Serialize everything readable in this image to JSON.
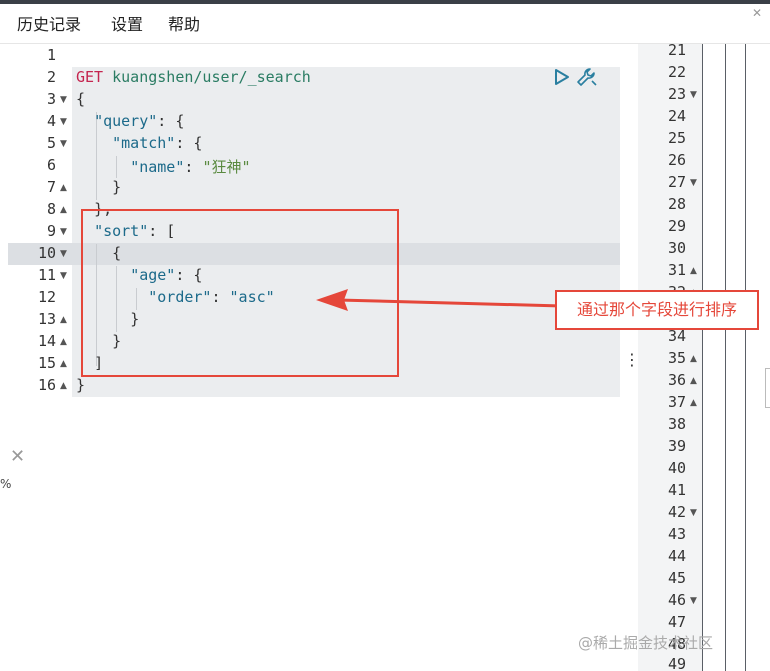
{
  "menu": {
    "history": "历史记录",
    "settings": "设置",
    "help": "帮助"
  },
  "editor": {
    "line_numbers": [
      "1",
      "2",
      "3",
      "4",
      "5",
      "6",
      "7",
      "8",
      "9",
      "10",
      "11",
      "12",
      "13",
      "14",
      "15",
      "16"
    ],
    "lines": {
      "l2_method": "GET",
      "l2_path": "kuangshen/user/_search",
      "l3": "{",
      "l4_key": "\"query\"",
      "l4_rest": ": {",
      "l5_key": "\"match\"",
      "l5_rest": ": {",
      "l6_key": "\"name\"",
      "l6_colon": ": ",
      "l6_val": "\"狂神\"",
      "l7": "}",
      "l8": "},",
      "l9_key": "\"sort\"",
      "l9_rest": ": [",
      "l10": "{",
      "l11_key": "\"age\"",
      "l11_rest": ": {",
      "l12_key": "\"order\"",
      "l12_colon": ": ",
      "l12_val": "\"asc\"",
      "l13": "}",
      "l14": "}",
      "l15": "]",
      "l16": "}"
    }
  },
  "result": {
    "line_numbers": [
      "21",
      "22",
      "23",
      "24",
      "25",
      "26",
      "27",
      "28",
      "29",
      "30",
      "31",
      "32",
      "33",
      "34",
      "35",
      "36",
      "37",
      "38",
      "39",
      "40",
      "41",
      "42",
      "43",
      "44",
      "45",
      "46",
      "47",
      "48",
      "49"
    ]
  },
  "left_panel": {
    "percent": "%"
  },
  "annotation": {
    "callout": "通过那个字段进行排序"
  },
  "watermark": "@稀土掘金技术社区",
  "colors": {
    "annotation_red": "#e5473a",
    "request_bg": "#ebedef",
    "keyword": "#1c6a8a",
    "string": "#5a8a40",
    "method": "#c5254f"
  }
}
